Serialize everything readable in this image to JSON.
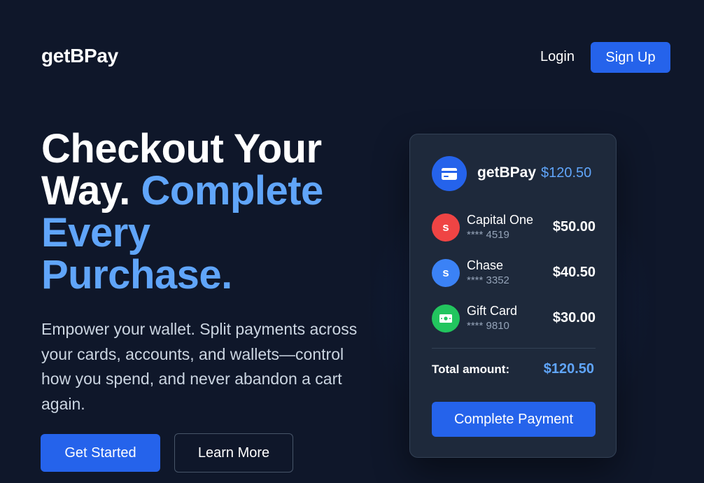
{
  "header": {
    "logo": "getBPay",
    "login_label": "Login",
    "signup_label": "Sign Up"
  },
  "hero": {
    "title_line1": "Checkout Your",
    "title_line2_plain": "Way.",
    "title_line2_accent": "Complete",
    "title_line3_accent": "Every",
    "title_line4_accent": "Purchase.",
    "subtitle": "Empower your wallet. Split payments across your cards, accounts, and wallets—control how you spend, and never abandon a cart again.",
    "primary_cta": "Get Started",
    "secondary_cta": "Learn More"
  },
  "card": {
    "brand_name": "getBPay",
    "brand_amount": "$120.50",
    "methods": [
      {
        "name": "Capital One",
        "mask": "**** 4519",
        "amount": "$50.00",
        "icon": "s",
        "icon_name": "capital-one-icon",
        "color": "#ef4444"
      },
      {
        "name": "Chase",
        "mask": "**** 3352",
        "amount": "$40.50",
        "icon": "s",
        "icon_name": "chase-icon",
        "color": "#3b82f6"
      },
      {
        "name": "Gift Card",
        "mask": "**** 9810",
        "amount": "$30.00",
        "icon": "",
        "icon_name": "money-bill-icon",
        "color": "#22c55e"
      }
    ],
    "total_label": "Total amount:",
    "total_amount": "$120.50",
    "complete_label": "Complete Payment"
  },
  "colors": {
    "background": "#0f172a",
    "card": "#1e293b",
    "accent": "#2563eb",
    "accent_text": "#60a5fa"
  }
}
